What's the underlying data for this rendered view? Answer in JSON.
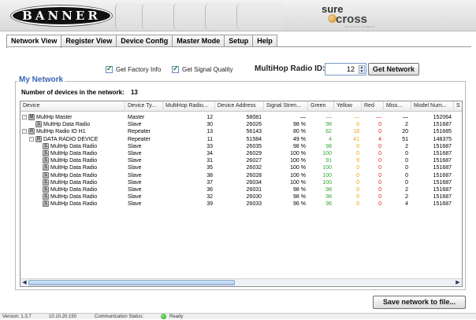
{
  "header": {
    "brand": "BANNER",
    "product_sure": "sure",
    "product_cross": "cross",
    "product_tagline": "wireless network"
  },
  "tabs": [
    {
      "label": "Network View",
      "active": true
    },
    {
      "label": "Register View",
      "active": false
    },
    {
      "label": "Device Config",
      "active": false
    },
    {
      "label": "Master Mode",
      "active": false
    },
    {
      "label": "Setup",
      "active": false
    },
    {
      "label": "Help",
      "active": false
    }
  ],
  "options": {
    "factory_info_label": "Get Factory Info",
    "factory_info_checked": true,
    "signal_quality_label": "Get Signal Quality",
    "signal_quality_checked": true,
    "radio_id_label": "MultiHop Radio ID:",
    "radio_id_value": "12",
    "get_network_label": "Get Network"
  },
  "network": {
    "title": "My Network",
    "device_count_label": "Number of devices in the network:",
    "device_count": "13",
    "columns": [
      "Device",
      "Device Ty...",
      "MultiHop Radio...",
      "Device Address",
      "Signal Stren...",
      "Green",
      "Yellow",
      "Red",
      "Miss...",
      "Model Num...",
      "S"
    ],
    "rows": [
      {
        "depth": 0,
        "expander": "-",
        "icon": "M",
        "device": "MultHp Master",
        "type": "Master",
        "radio": "12",
        "address": "58081",
        "signal": "—",
        "green": "—",
        "yellow": "—",
        "red": "—",
        "miss": "—",
        "model": "152064"
      },
      {
        "depth": 1,
        "expander": "",
        "icon": "S",
        "device": "MultHp Data  Radio",
        "type": "Slave",
        "radio": "30",
        "address": "26026",
        "signal": "98 %",
        "green": "98",
        "yellow": "0",
        "red": "0",
        "miss": "2",
        "model": "151687"
      },
      {
        "depth": 0,
        "expander": "-",
        "icon": "R",
        "device": "MultHp Radio IO H1",
        "type": "Repeater",
        "radio": "13",
        "address": "56143",
        "signal": "80 %",
        "green": "62",
        "yellow": "18",
        "red": "0",
        "miss": "20",
        "model": "151685"
      },
      {
        "depth": 1,
        "expander": "-",
        "icon": "R",
        "device": "DATA  RADIO DEVICE",
        "type": "Repeater",
        "radio": "11",
        "address": "51584",
        "signal": "49 %",
        "green": "4",
        "yellow": "41",
        "red": "4",
        "miss": "51",
        "model": "148375"
      },
      {
        "depth": 2,
        "expander": "",
        "icon": "S",
        "device": "MultHp Data  Radio",
        "type": "Slave",
        "radio": "33",
        "address": "26035",
        "signal": "98 %",
        "green": "98",
        "yellow": "0",
        "red": "0",
        "miss": "2",
        "model": "151687"
      },
      {
        "depth": 2,
        "expander": "",
        "icon": "S",
        "device": "MultHp Data  Radio",
        "type": "Slave",
        "radio": "34",
        "address": "26029",
        "signal": "100 %",
        "green": "100",
        "yellow": "0",
        "red": "0",
        "miss": "0",
        "model": "151687"
      },
      {
        "depth": 2,
        "expander": "",
        "icon": "S",
        "device": "MultHp Data  Radio",
        "type": "Slave",
        "radio": "31",
        "address": "26027",
        "signal": "100 %",
        "green": "91",
        "yellow": "9",
        "red": "0",
        "miss": "0",
        "model": "151687"
      },
      {
        "depth": 2,
        "expander": "",
        "icon": "S",
        "device": "MultHp Data  Radio",
        "type": "Slave",
        "radio": "35",
        "address": "26032",
        "signal": "100 %",
        "green": "100",
        "yellow": "0",
        "red": "0",
        "miss": "0",
        "model": "151687"
      },
      {
        "depth": 2,
        "expander": "",
        "icon": "S",
        "device": "MultHp Data  Radio",
        "type": "Slave",
        "radio": "38",
        "address": "26028",
        "signal": "100 %",
        "green": "100",
        "yellow": "0",
        "red": "0",
        "miss": "0",
        "model": "151687"
      },
      {
        "depth": 2,
        "expander": "",
        "icon": "S",
        "device": "MultHp Data  Radio",
        "type": "Slave",
        "radio": "37",
        "address": "26034",
        "signal": "100 %",
        "green": "100",
        "yellow": "0",
        "red": "0",
        "miss": "0",
        "model": "151687"
      },
      {
        "depth": 2,
        "expander": "",
        "icon": "S",
        "device": "MultHp Data  Radio",
        "type": "Slave",
        "radio": "36",
        "address": "26031",
        "signal": "98 %",
        "green": "98",
        "yellow": "0",
        "red": "0",
        "miss": "2",
        "model": "151687"
      },
      {
        "depth": 2,
        "expander": "",
        "icon": "S",
        "device": "MultHp Data  Radio",
        "type": "Slave",
        "radio": "32",
        "address": "26030",
        "signal": "98 %",
        "green": "98",
        "yellow": "0",
        "red": "0",
        "miss": "2",
        "model": "151687"
      },
      {
        "depth": 2,
        "expander": "",
        "icon": "S",
        "device": "MultHp Data  Radio",
        "type": "Slave",
        "radio": "39",
        "address": "26033",
        "signal": "96 %",
        "green": "96",
        "yellow": "0",
        "red": "0",
        "miss": "4",
        "model": "151687"
      }
    ]
  },
  "save_button_label": "Save network to file...",
  "status_bar": {
    "version": "Version: 1.3.7",
    "ip": "10.10.20.150",
    "comm_label": "Communication Status:",
    "comm_value": "Ready"
  },
  "colors": {
    "accent_title": "#3a66b0",
    "green": "#3aa33a",
    "yellow": "#e8a316",
    "red": "#e02020",
    "status_led": "#1c9a1c"
  },
  "icons": [
    "checkbox-icon",
    "spinner-icon",
    "tree-expander-icon",
    "device-type-icon",
    "scroll-left-arrow-icon",
    "scroll-right-arrow-icon",
    "status-led-icon"
  ]
}
